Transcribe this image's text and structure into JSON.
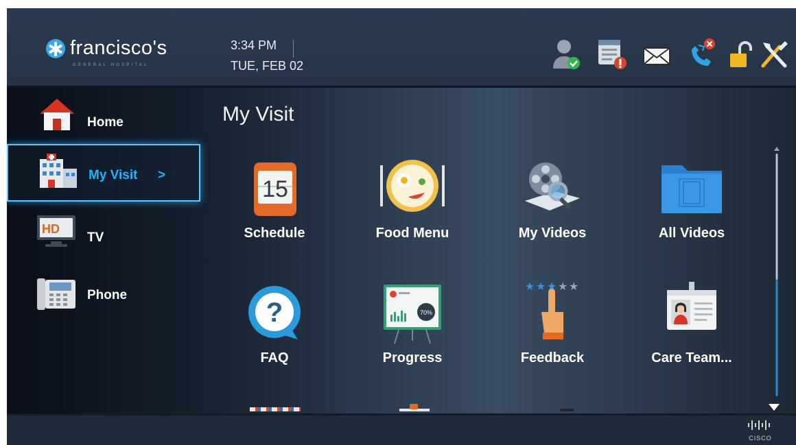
{
  "header": {
    "logo_name": "francisco's",
    "logo_tagline": "GENERAL HOSPITAL",
    "time": "3:34 PM",
    "date": "TUE, FEB 02",
    "status_icons": [
      "user-available-icon",
      "notes-alert-icon",
      "mail-icon",
      "missed-call-icon",
      "unlock-icon",
      "tools-icon"
    ]
  },
  "nav": {
    "items": [
      {
        "label": "Home",
        "icon": "home-icon"
      },
      {
        "label": "My Visit",
        "icon": "hospital-icon",
        "suffix": ">",
        "selected": true
      },
      {
        "label": "TV",
        "icon": "tv-icon",
        "badge": "HD"
      },
      {
        "label": "Phone",
        "icon": "phone-icon"
      }
    ]
  },
  "main": {
    "title": "My Visit",
    "tiles": [
      {
        "label": "Schedule",
        "icon": "calendar-icon",
        "number": "15"
      },
      {
        "label": "Food Menu",
        "icon": "food-plate-icon"
      },
      {
        "label": "My Videos",
        "icon": "film-reel-icon"
      },
      {
        "label": "All Videos",
        "icon": "folder-icon"
      },
      {
        "label": "FAQ",
        "icon": "question-icon"
      },
      {
        "label": "Progress",
        "icon": "progress-board-icon",
        "percent": "70%"
      },
      {
        "label": "Feedback",
        "icon": "rating-hand-icon",
        "rating": 3,
        "rating_max": 5
      },
      {
        "label": "Care Team...",
        "icon": "id-badge-icon"
      }
    ]
  },
  "footer": {
    "brand": "CISCO"
  },
  "colors": {
    "accent": "#1fb4ff",
    "selected_border": "#5ec6ff",
    "background": "#2a3a4d"
  }
}
